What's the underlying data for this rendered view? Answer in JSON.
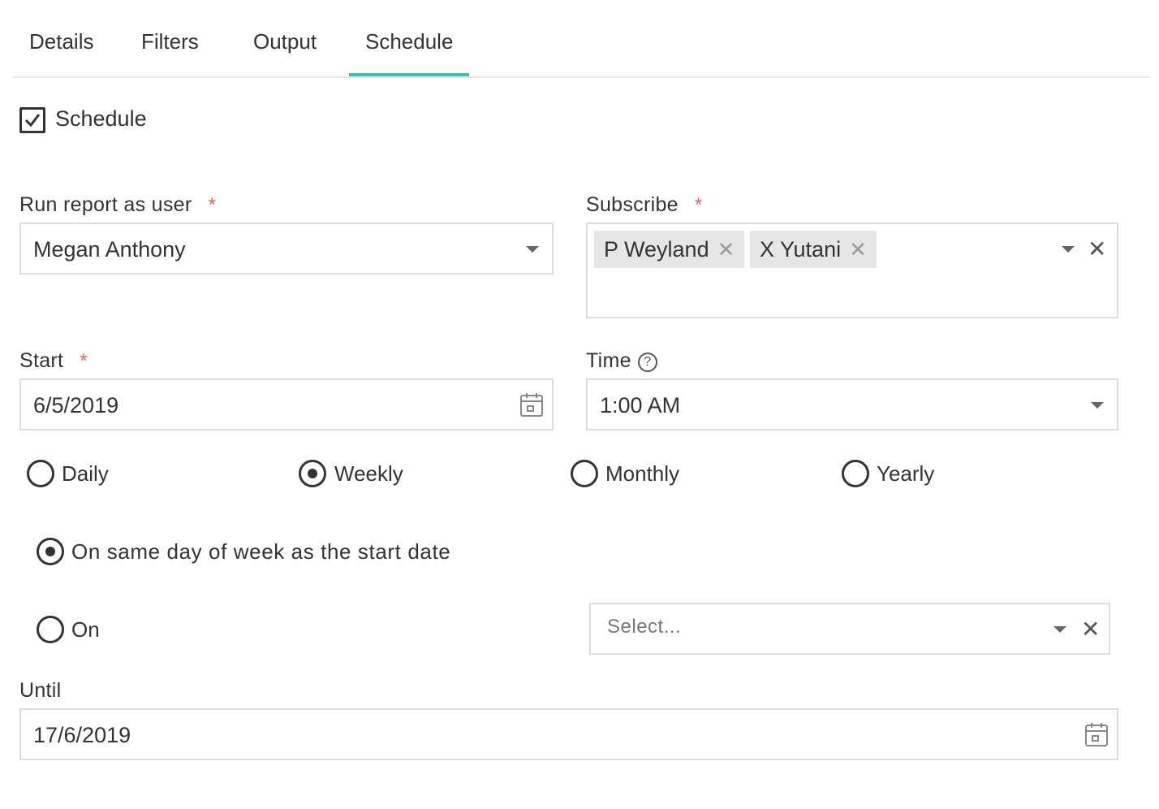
{
  "tabs": [
    {
      "label": "Details"
    },
    {
      "label": "Filters"
    },
    {
      "label": "Output"
    },
    {
      "label": "Schedule",
      "active": true
    }
  ],
  "schedule_checkbox": {
    "label": "Schedule",
    "checked": true
  },
  "run_as": {
    "label": "Run report as user",
    "required_mark": "*",
    "value": "Megan Anthony"
  },
  "subscribe": {
    "label": "Subscribe",
    "required_mark": "*",
    "tags": [
      {
        "label": "P Weyland"
      },
      {
        "label": "X Yutani"
      }
    ],
    "remove_glyph": "✕"
  },
  "start": {
    "label": "Start",
    "required_mark": "*",
    "value": "6/5/2019"
  },
  "time": {
    "label": "Time",
    "help_glyph": "?",
    "value": "1:00 AM"
  },
  "frequency": {
    "options": [
      {
        "label": "Daily",
        "checked": false
      },
      {
        "label": "Weekly",
        "checked": true
      },
      {
        "label": "Monthly",
        "checked": false
      },
      {
        "label": "Yearly",
        "checked": false
      }
    ]
  },
  "weekly_options": {
    "same_day": {
      "label": "On same day of week as the start date",
      "checked": true
    },
    "on": {
      "label": "On",
      "checked": false
    },
    "on_select_placeholder": "Select..."
  },
  "until": {
    "label": "Until",
    "value": "17/6/2019"
  },
  "clear_glyph": "✕",
  "colors": {
    "accent": "#3cc2b8",
    "required": "#e8645a"
  }
}
